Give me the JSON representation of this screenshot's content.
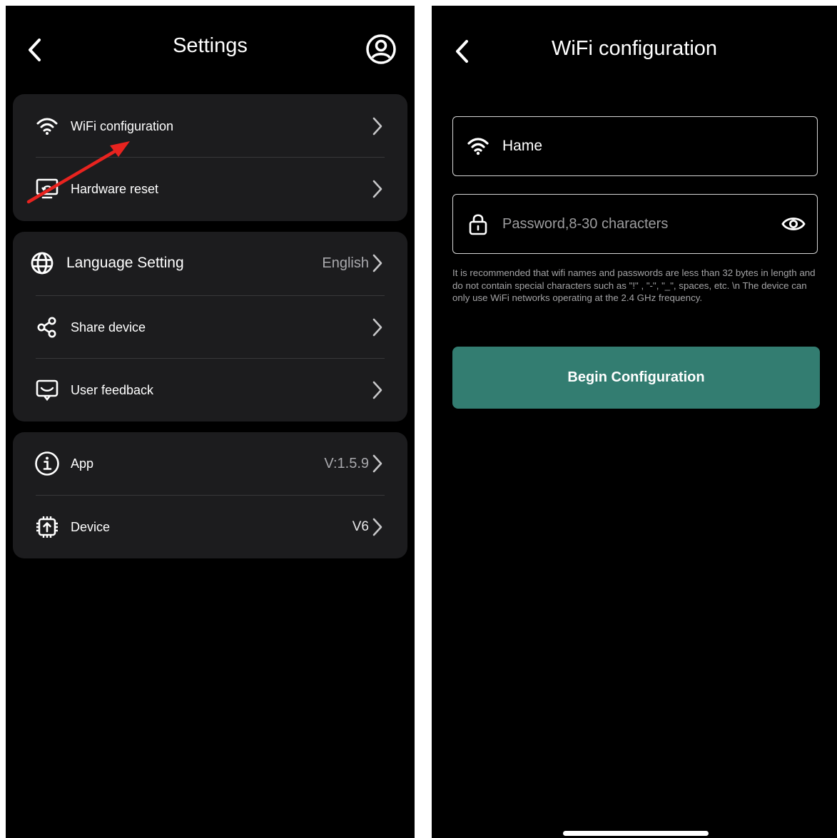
{
  "settings_screen": {
    "title": "Settings",
    "icons": {
      "back": "chevron-left-icon",
      "profile": "user-circle-icon"
    },
    "groups": [
      {
        "items": [
          {
            "label": "WiFi configuration",
            "icon": "wifi-icon",
            "value": ""
          },
          {
            "label": "Hardware reset",
            "icon": "screen-reset-icon",
            "value": ""
          }
        ]
      },
      {
        "items": [
          {
            "label": "Language Setting",
            "icon": "globe-icon",
            "value": "English"
          },
          {
            "label": "Share device",
            "icon": "share-icon",
            "value": ""
          },
          {
            "label": "User feedback",
            "icon": "feedback-icon",
            "value": ""
          }
        ]
      },
      {
        "items": [
          {
            "label": "App",
            "icon": "info-icon",
            "value": "V:1.5.9"
          },
          {
            "label": "Device",
            "icon": "chip-icon",
            "value": "V6"
          }
        ]
      }
    ],
    "annotation": {
      "type": "red-arrow",
      "color": "#e8231f",
      "points_to": "WiFi configuration"
    }
  },
  "wifi_screen": {
    "title": "WiFi configuration",
    "network_name": "Hame",
    "password_placeholder": "Password,8-30 characters",
    "hint": "It is recommended that wifi names and passwords are less than 32 bytes in length and do not contain special characters such as \"!\" , \"-\", \"_\", spaces, etc. \\n The device can only use WiFi networks operating at the 2.4 GHz frequency.",
    "begin_button": "Begin Configuration",
    "icons": {
      "back": "chevron-left-icon",
      "wifi": "wifi-icon",
      "lock": "lock-icon",
      "eye": "eye-icon"
    }
  },
  "colors": {
    "background": "#000000",
    "card": "#1c1c1e",
    "accent": "#337d71",
    "annotation_red": "#e8231f",
    "secondary_text": "#a9a9ad"
  }
}
